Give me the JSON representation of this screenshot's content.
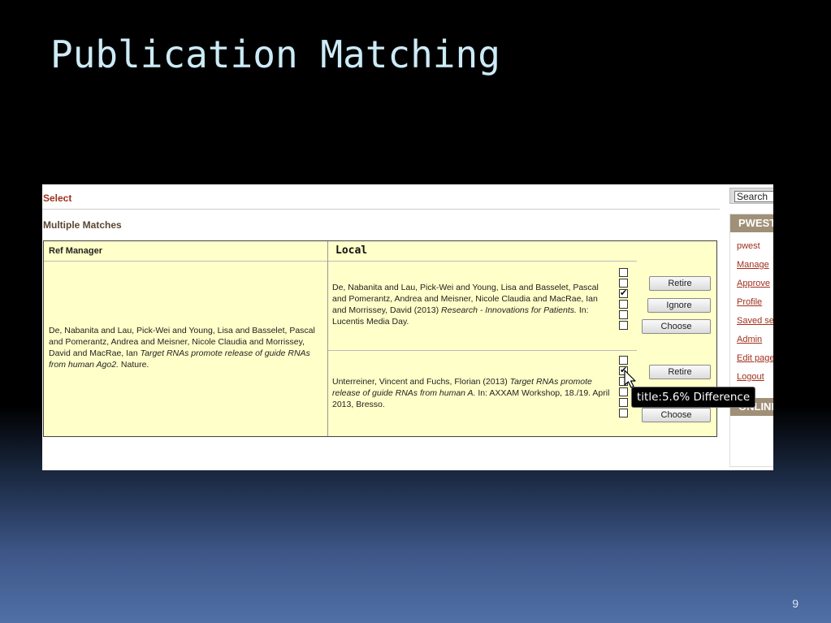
{
  "slide": {
    "title": "Publication Matching",
    "number": "9"
  },
  "page": {
    "select_label": "Select",
    "multiple_matches_label": "Multiple Matches",
    "table": {
      "ref_header": "Ref Manager",
      "local_header": "Local",
      "ref_entry": {
        "authors": "De, Nabanita and Lau, Pick-Wei and Young, Lisa and Basselet, Pascal and Pomerantz, Andrea and Meisner, Nicole Claudia and Morrissey, David and MacRae, Ian ",
        "title": "Target RNAs promote release of guide RNAs from human Ago2.",
        "source": " Nature."
      },
      "local_entries": [
        {
          "authors": "De, Nabanita and Lau, Pick-Wei and Young, Lisa and Basselet, Pascal and Pomerantz, Andrea and Meisner, Nicole Claudia and MacRae, Ian and Morrissey, David (2013) ",
          "title": "Research - Innovations for Patients.",
          "source": " In: Lucentis Media Day.",
          "checkboxes": [
            false,
            false,
            true,
            false,
            false,
            false
          ],
          "buttons": {
            "retire": "Retire",
            "ignore": "Ignore",
            "choose": "Choose"
          }
        },
        {
          "authors": "Unterreiner, Vincent and Fuchs, Florian (2013) ",
          "title": "Target RNAs promote release of guide RNAs from human A.",
          "source": " In: AXXAM Workshop, 18./19. April 2013, Bresso.",
          "checkboxes": [
            false,
            true,
            false,
            false,
            false,
            false
          ],
          "buttons": {
            "retire": "Retire",
            "choose": "Choose"
          }
        }
      ]
    }
  },
  "sidebar": {
    "search_value": "Search",
    "header": "PWEST",
    "user": "pwest",
    "links": [
      "Manage",
      "Approve",
      "Profile",
      "Saved se",
      "Admin",
      "Edit page",
      "Logout"
    ],
    "header_2": "ONLINE"
  },
  "tooltip": {
    "text": "title:5.6% Difference"
  },
  "icons": {
    "check": "checkmark-icon",
    "cursor": "mouse-pointer-icon"
  },
  "colors": {
    "title_text": "#cdebf6",
    "accent_red": "#a0301c",
    "table_bg": "#ffffc9",
    "sidebar_header": "#a09078"
  }
}
